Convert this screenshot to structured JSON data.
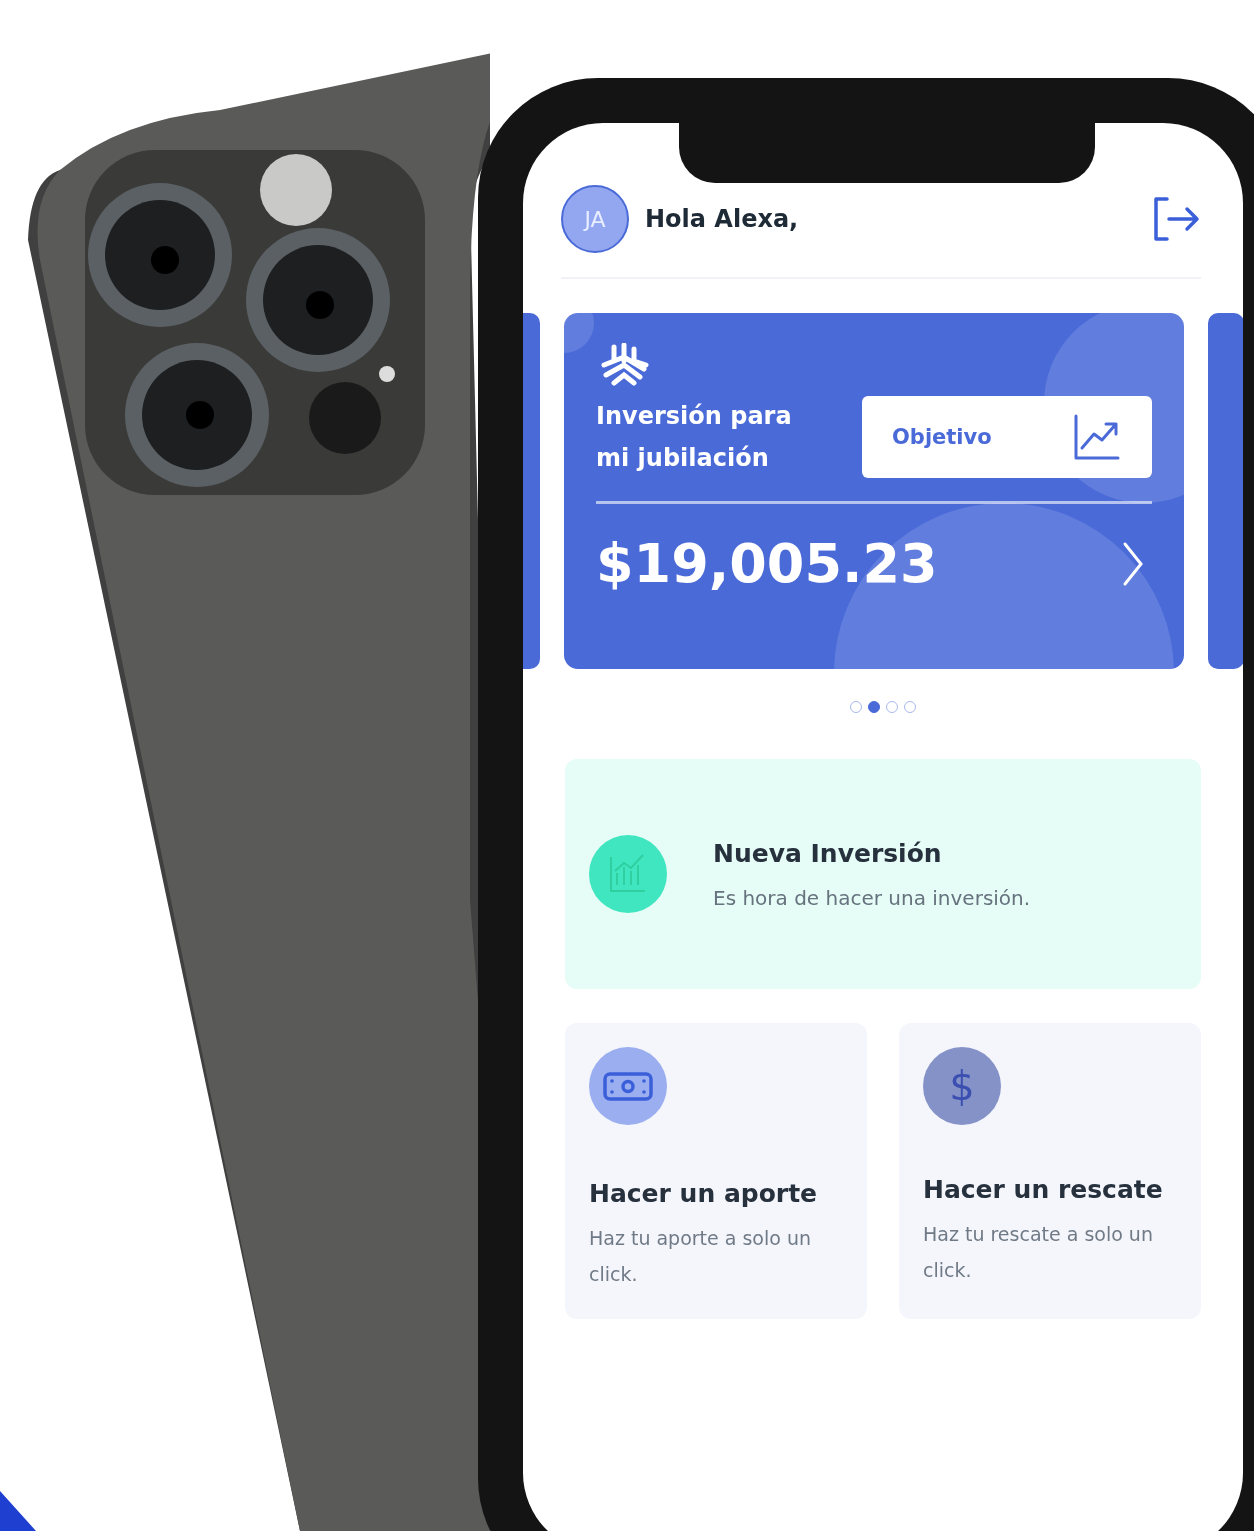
{
  "header": {
    "avatar_initials": "JA",
    "greeting": "Hola Alexa,"
  },
  "carousel": {
    "card": {
      "title": "Inversión para mi jubilación",
      "goal_button": "Objetivo",
      "amount": "$19,005.23"
    },
    "dots": [
      {
        "selected": false
      },
      {
        "selected": true
      },
      {
        "selected": false
      },
      {
        "selected": false
      }
    ]
  },
  "promo": {
    "title": "Nueva Inversión",
    "subtitle": "Es hora de hacer una inversión."
  },
  "actions": [
    {
      "kind": "cash",
      "title": "Hacer un aporte",
      "description": "Haz tu aporte a solo un click."
    },
    {
      "kind": "dollar",
      "glyph": "$",
      "title": "Hacer un rescate",
      "description": "Haz tu rescate a solo un click."
    }
  ]
}
